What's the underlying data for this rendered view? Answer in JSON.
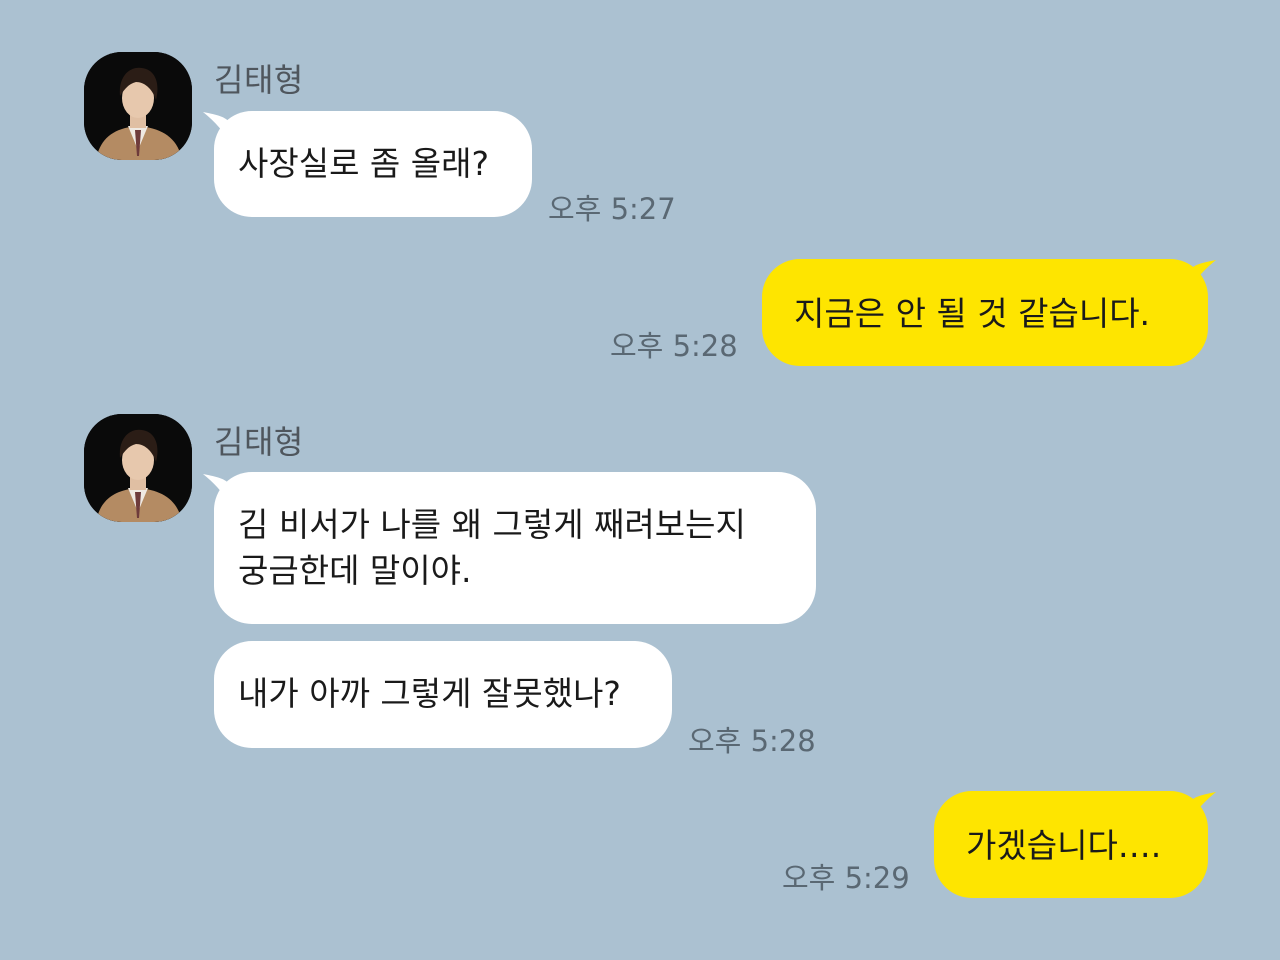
{
  "colors": {
    "background": "#abc1d1",
    "incoming_bubble": "#ffffff",
    "outgoing_bubble": "#fee500"
  },
  "messages": [
    {
      "sender": "김태형",
      "avatar_icon": "profile-photo-icon",
      "bubbles": [
        {
          "text": "사장실로 좀 올래?"
        }
      ],
      "time": "오후 5:27"
    },
    {
      "outgoing": true,
      "text": "지금은 안 될 것 같습니다.",
      "time": "오후 5:28"
    },
    {
      "sender": "김태형",
      "avatar_icon": "profile-photo-icon",
      "bubbles": [
        {
          "lines": [
            "김 비서가 나를 왜 그렇게 째려보는지",
            "궁금한데 말이야."
          ]
        },
        {
          "text": "내가 아까 그렇게 잘못했나?"
        }
      ],
      "time": "오후 5:28"
    },
    {
      "outgoing": true,
      "text": "가겠습니다….",
      "time": "오후 5:29"
    }
  ]
}
